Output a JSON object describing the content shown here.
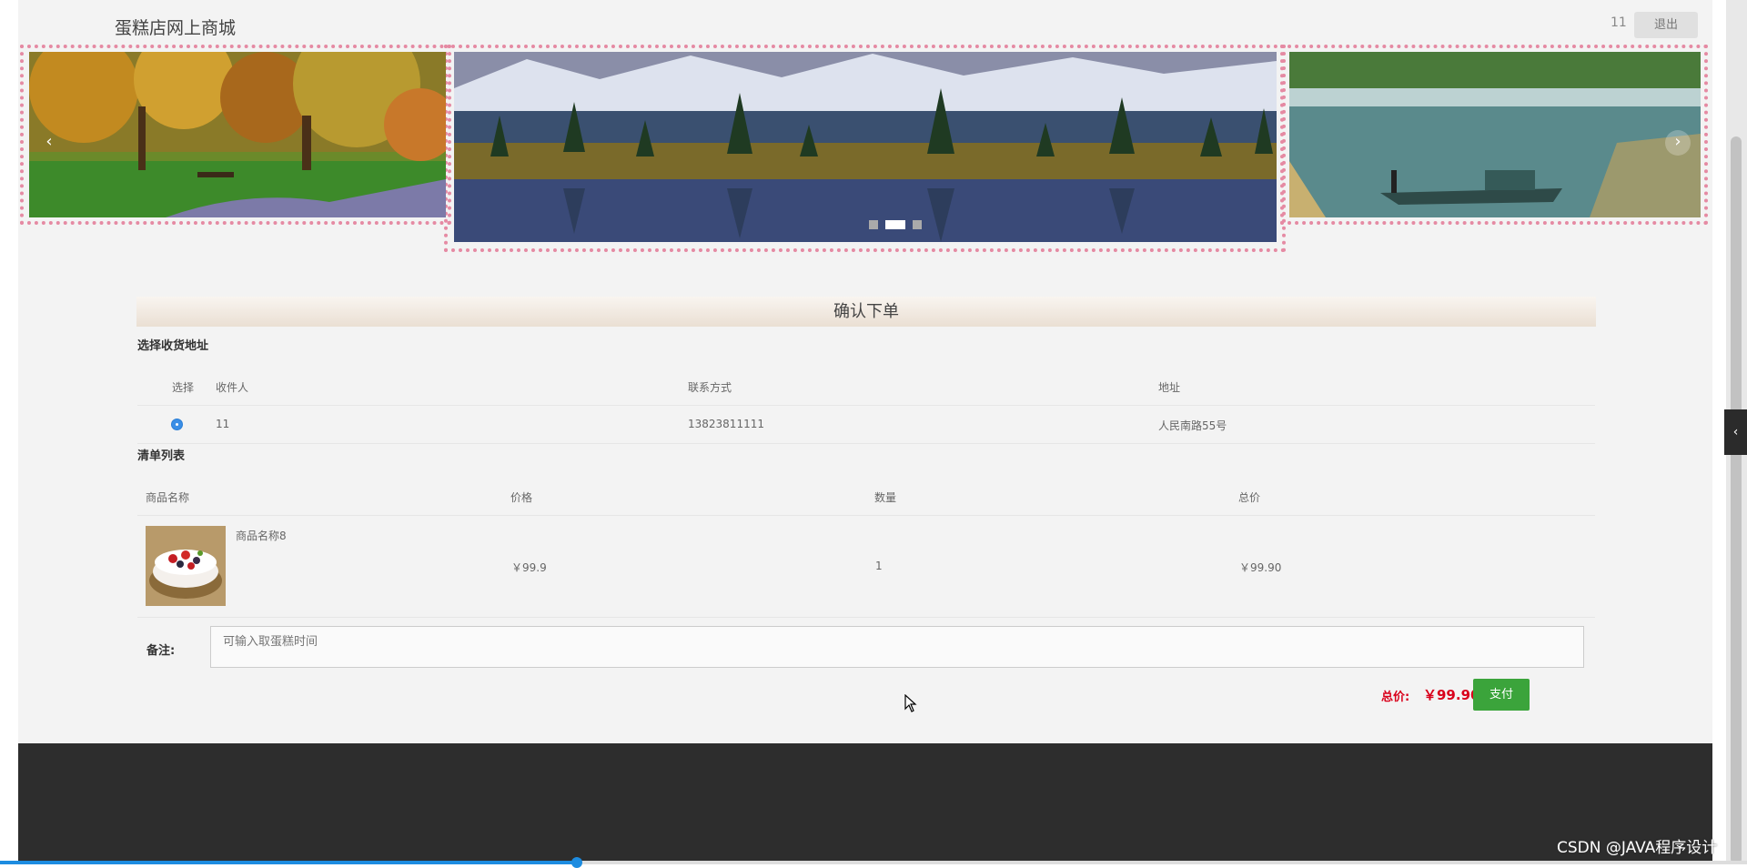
{
  "header": {
    "site_title": "蛋糕店网上商城",
    "user_name": "11",
    "logout_label": "退出"
  },
  "carousel": {
    "prev_icon": "chevron-left-icon",
    "prev_symbol": "‹",
    "next_icon": "chevron-right-icon",
    "next_symbol": "›",
    "active_index": 1,
    "slide_count": 3
  },
  "order": {
    "title": "确认下单",
    "address_section_label": "选择收货地址",
    "address_headers": {
      "select": "选择",
      "recipient": "收件人",
      "contact": "联系方式",
      "address": "地址"
    },
    "addresses": [
      {
        "recipient": "11",
        "contact": "13823811111",
        "address": "人民南路55号",
        "selected": true
      }
    ],
    "items_section_label": "清单列表",
    "item_headers": {
      "name": "商品名称",
      "price": "价格",
      "quantity": "数量",
      "total": "总价"
    },
    "items": [
      {
        "name": "商品名称8",
        "price": "￥99.9",
        "quantity": "1",
        "total": "￥99.90"
      }
    ],
    "remark_label": "备注:",
    "remark_placeholder": "可输入取蛋糕时间",
    "total_label": "总价:",
    "total_value": "￥99.90",
    "pay_label": "支付"
  },
  "side_toggle_symbol": "‹",
  "video_progress": 0.33,
  "watermark": "CSDN @JAVA程序设计"
}
